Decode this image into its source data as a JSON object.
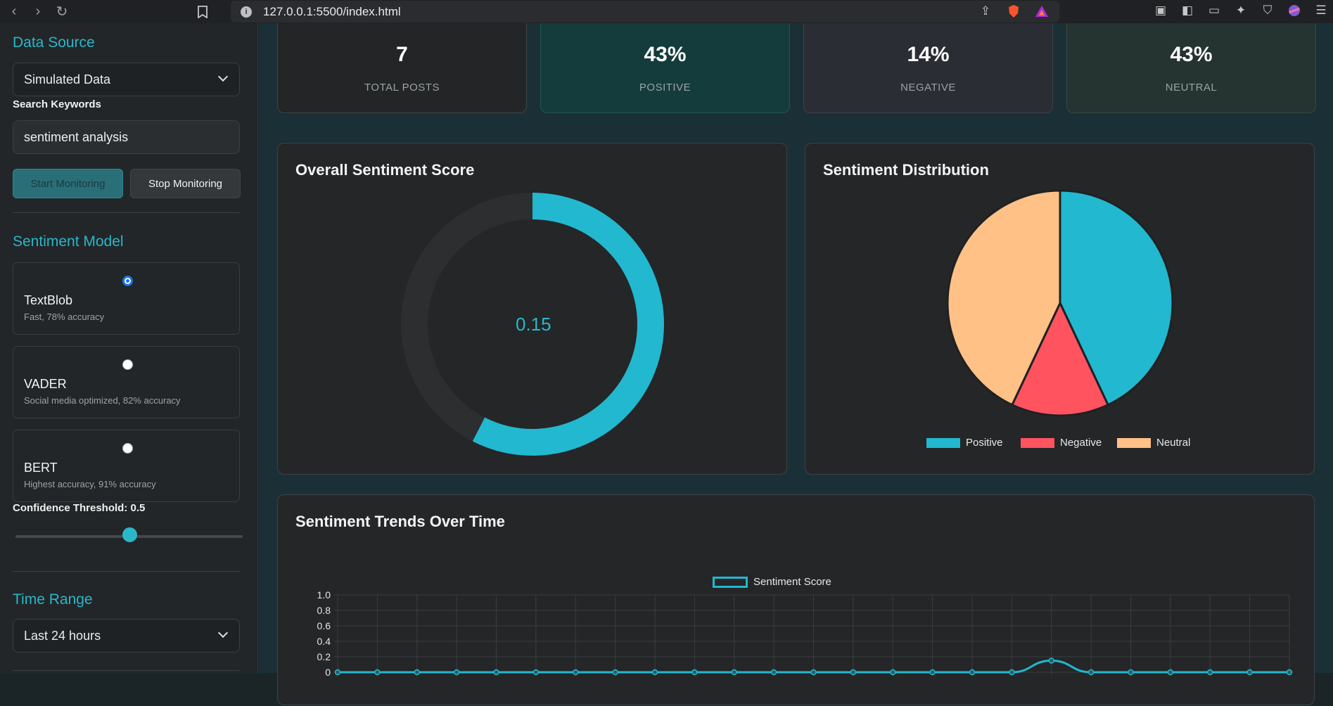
{
  "browser": {
    "url": "127.0.0.1:5500/index.html"
  },
  "sidebar": {
    "data_source": {
      "title": "Data Source",
      "selected": "Simulated Data"
    },
    "keywords": {
      "label": "Search Keywords",
      "value": "sentiment analysis"
    },
    "buttons": {
      "start": "Start Monitoring",
      "stop": "Stop Monitoring"
    },
    "model": {
      "title": "Sentiment Model",
      "options": [
        {
          "name": "TextBlob",
          "desc": "Fast, 78% accuracy",
          "checked": true
        },
        {
          "name": "VADER",
          "desc": "Social media optimized, 82% accuracy",
          "checked": false
        },
        {
          "name": "BERT",
          "desc": "Highest accuracy, 91% accuracy",
          "checked": false
        }
      ]
    },
    "confidence": {
      "label": "Confidence Threshold: 0.5",
      "value": 0.5
    },
    "time_range": {
      "title": "Time Range",
      "selected": "Last 24 hours"
    }
  },
  "stats": [
    {
      "value": "7",
      "label": "TOTAL POSTS",
      "bg": "#232527",
      "border": "#3d4548"
    },
    {
      "value": "43%",
      "label": "POSITIVE",
      "bg": "#153c3c",
      "border": "#235555"
    },
    {
      "value": "14%",
      "label": "NEGATIVE",
      "bg": "#2a2d33",
      "border": "#3e424a"
    },
    {
      "value": "43%",
      "label": "NEUTRAL",
      "bg": "#253331",
      "border": "#384745"
    }
  ],
  "overall": {
    "title": "Overall Sentiment Score",
    "display": "0.15",
    "score": 0.15,
    "fill_fraction": 0.575,
    "fill_color": "#22b8cf",
    "track_color": "#2c2e30"
  },
  "distribution": {
    "title": "Sentiment Distribution",
    "chart_data": {
      "type": "pie",
      "labels": [
        "Positive",
        "Negative",
        "Neutral"
      ],
      "values": [
        43,
        14,
        43
      ],
      "colors": [
        "#22b8cf",
        "#ff5460",
        "#ffc185"
      ]
    }
  },
  "trends": {
    "title": "Sentiment Trends Over Time",
    "legend": "Sentiment Score",
    "chart_data": {
      "type": "line",
      "series": [
        {
          "name": "Sentiment Score",
          "values": [
            0,
            0,
            0,
            0,
            0,
            0,
            0,
            0,
            0,
            0,
            0,
            0,
            0,
            0,
            0,
            0,
            0,
            0,
            0.15,
            0,
            0,
            0,
            0,
            0,
            0
          ]
        }
      ],
      "ylim": [
        0,
        1.0
      ],
      "yticks": [
        "1.0",
        "0.8",
        "0.6",
        "0.4",
        "0.2",
        "0"
      ],
      "color": "#22b8cf"
    }
  }
}
